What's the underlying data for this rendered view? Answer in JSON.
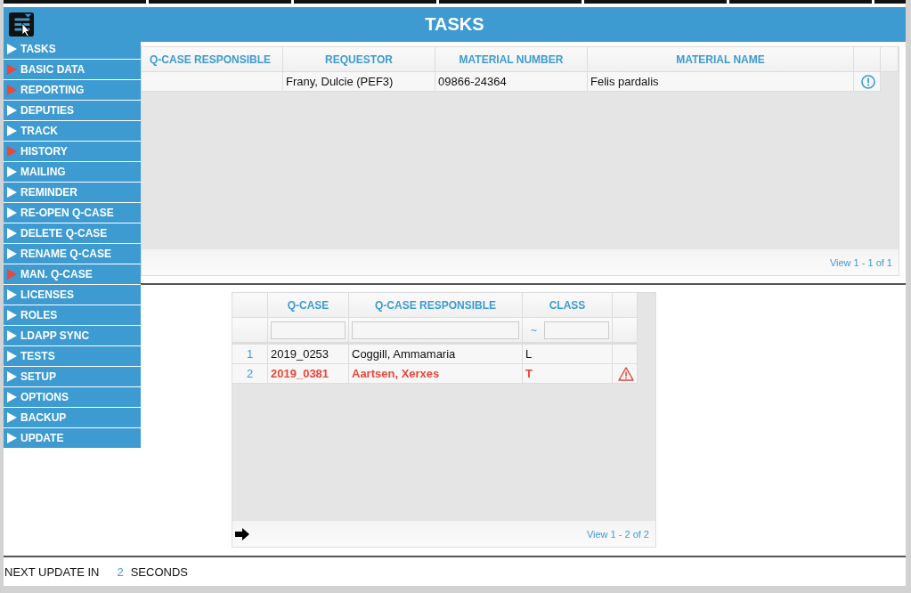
{
  "header": {
    "title": "TASKS"
  },
  "menu": {
    "items": [
      {
        "label": "TASKS",
        "flagged": false
      },
      {
        "label": "BASIC DATA",
        "flagged": true
      },
      {
        "label": "REPORTING",
        "flagged": true
      },
      {
        "label": "DEPUTIES",
        "flagged": false
      },
      {
        "label": "TRACK",
        "flagged": false
      },
      {
        "label": "HISTORY",
        "flagged": true
      },
      {
        "label": "MAILING",
        "flagged": false
      },
      {
        "label": "REMINDER",
        "flagged": false
      },
      {
        "label": "RE-OPEN Q-CASE",
        "flagged": false
      },
      {
        "label": "DELETE Q-CASE",
        "flagged": false
      },
      {
        "label": "RENAME Q-CASE",
        "flagged": false
      },
      {
        "label": "MAN. Q-CASE",
        "flagged": true
      },
      {
        "label": "LICENSES",
        "flagged": false
      },
      {
        "label": "ROLES",
        "flagged": false
      },
      {
        "label": "LDAPP SYNC",
        "flagged": false
      },
      {
        "label": "TESTS",
        "flagged": false
      },
      {
        "label": "SETUP",
        "flagged": false
      },
      {
        "label": "OPTIONS",
        "flagged": false
      },
      {
        "label": "BACKUP",
        "flagged": false
      },
      {
        "label": "UPDATE",
        "flagged": false
      }
    ]
  },
  "top_grid": {
    "columns": [
      "Q-CASE RESPONSIBLE",
      "REQUESTOR",
      "MATERIAL NUMBER",
      "MATERIAL NAME"
    ],
    "rows": [
      {
        "requestor": "Frany, Dulcie (PEF3)",
        "material_number": "09866-24364",
        "material_name": "Felis pardalis",
        "kind": "info"
      }
    ],
    "pager": "View 1 - 1 of 1"
  },
  "bottom_grid": {
    "columns": [
      "Q-CASE",
      "Q-CASE RESPONSIBLE",
      "CLASS"
    ],
    "class_filter_operator": "~",
    "rows": [
      {
        "number": "1",
        "q_case": "2019_0253",
        "responsible": "Coggill, Ammamaria",
        "class": "L",
        "alert": false
      },
      {
        "number": "2",
        "q_case": "2019_0381",
        "responsible": "Aartsen, Xerxes",
        "class": "T",
        "alert": true
      }
    ],
    "pager": "View 1 - 2 of 2"
  },
  "status_bar": {
    "prefix": "NEXT UPDATE IN",
    "count": "2",
    "suffix": "SECONDS"
  }
}
